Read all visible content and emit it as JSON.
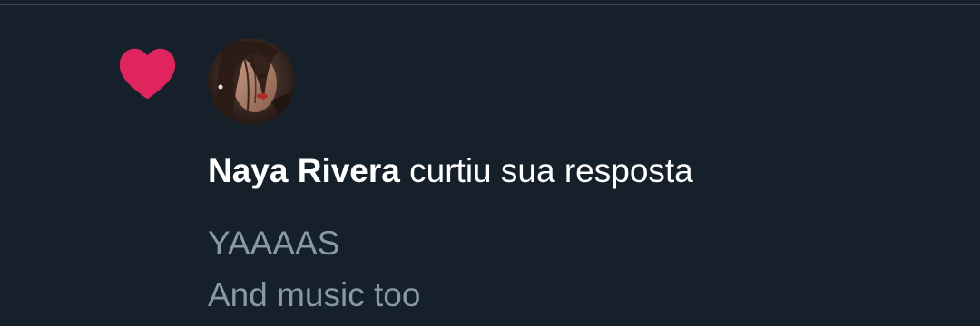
{
  "notification": {
    "actor_name": "Naya Rivera",
    "action_text": "curtiu sua resposta",
    "icon": "heart-icon",
    "avatar": "user-avatar-photo",
    "reply_lines": [
      "YAAAAS",
      "And music too"
    ]
  },
  "colors": {
    "background": "#15202b",
    "heart": "#e0245e",
    "primary_text": "#ffffff",
    "secondary_text": "#8899a6"
  }
}
